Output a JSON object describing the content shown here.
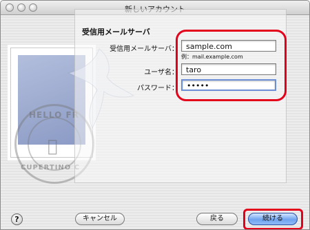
{
  "window": {
    "title": "新しいアカウント"
  },
  "section": {
    "title": "受信用メールサーバ"
  },
  "server": {
    "label": "受信用メールサーバ：",
    "value": "sample.com",
    "hint": "例：mail.example.com"
  },
  "username": {
    "label": "ユーザ名：",
    "value": "taro"
  },
  "password": {
    "label": "パスワード：",
    "value": "•••••"
  },
  "stamp": {
    "postmark_top": "HELLO FR",
    "postmark_bottom": "CUPERTINO C"
  },
  "buttons": {
    "help": "?",
    "cancel": "キャンセル",
    "back": "戻る",
    "continue": "続ける"
  },
  "highlight_color": "#e3001b"
}
